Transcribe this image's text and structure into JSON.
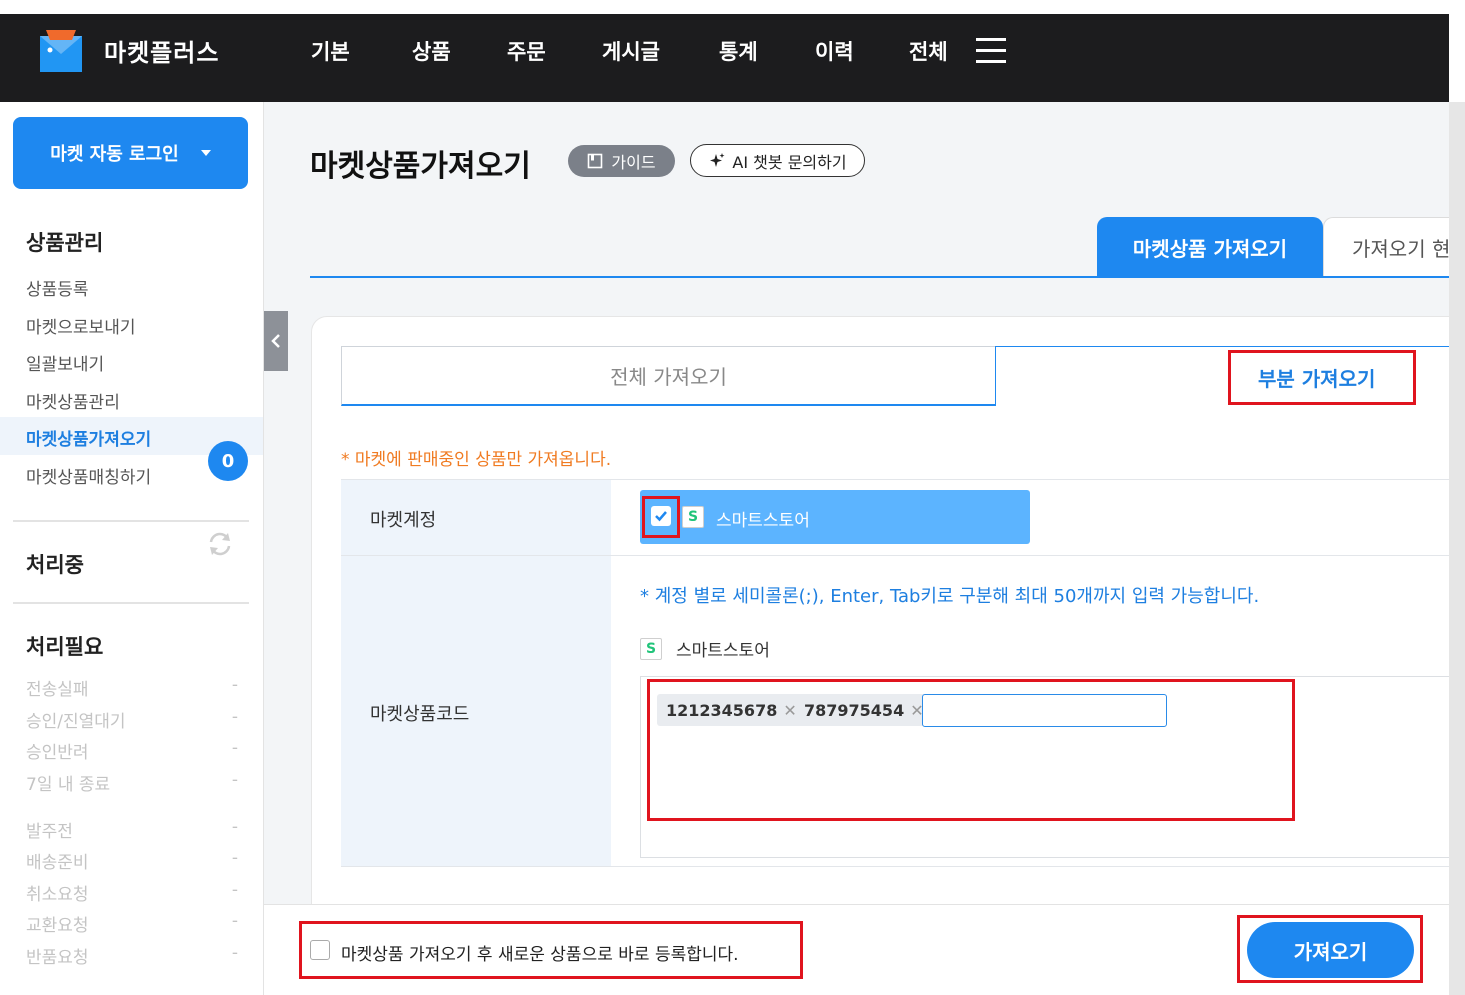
{
  "header": {
    "brand": "마켓플러스",
    "nav": [
      "기본",
      "상품",
      "주문",
      "게시글",
      "통계",
      "이력",
      "전체"
    ]
  },
  "sidebar": {
    "auto_login_label": "마켓 자동 로그인",
    "section_title": "상품관리",
    "items": [
      {
        "label": "상품등록"
      },
      {
        "label": "마켓으로보내기"
      },
      {
        "label": "일괄보내기"
      },
      {
        "label": "마켓상품관리"
      },
      {
        "label": "마켓상품가져오기",
        "active": true
      },
      {
        "label": "마켓상품매칭하기"
      }
    ],
    "processing": {
      "title": "처리중",
      "count": "0"
    },
    "needs_action": {
      "title": "처리필요",
      "rows": [
        {
          "label": "전송실패",
          "value": "-"
        },
        {
          "label": "승인/진열대기",
          "value": "-"
        },
        {
          "label": "승인반려",
          "value": "-"
        },
        {
          "label": "7일 내 종료",
          "value": "-"
        },
        {
          "label": "발주전",
          "value": "-"
        },
        {
          "label": "배송준비",
          "value": "-"
        },
        {
          "label": "취소요청",
          "value": "-"
        },
        {
          "label": "교환요청",
          "value": "-"
        },
        {
          "label": "반품요청",
          "value": "-"
        }
      ]
    }
  },
  "main": {
    "title": "마켓상품가져오기",
    "guide_label": "가이드",
    "ai_label": "AI 챗봇 문의하기",
    "top_tabs": [
      "마켓상품 가져오기",
      "가져오기 현황"
    ],
    "sub_tabs": [
      "전체 가져오기",
      "부분 가져오기"
    ],
    "notice": "* 마켓에 판매중인 상품만 가져옵니다.",
    "form": {
      "account_label": "마켓계정",
      "account_name": "스마트스토어",
      "account_icon_letter": "S",
      "code_label": "마켓상품코드",
      "hint": "* 계정 별로 세미콜론(;), Enter, Tab키로 구분해 최대 50개까지 입력 가능합니다.",
      "code_market": "스마트스토어",
      "codes": [
        "1212345678",
        "787975454"
      ],
      "code_input_value": ""
    }
  },
  "footer": {
    "checkbox_label": "마켓상품 가져오기 후 새로운 상품으로 바로 등록합니다.",
    "checkbox_checked": false,
    "import_button": "가져오기"
  },
  "colors": {
    "accent": "#1e88f0",
    "chip": "#5cb4ff",
    "notice": "#f07b22",
    "highlight": "#e0141e",
    "topbar": "#1c1c1e"
  }
}
